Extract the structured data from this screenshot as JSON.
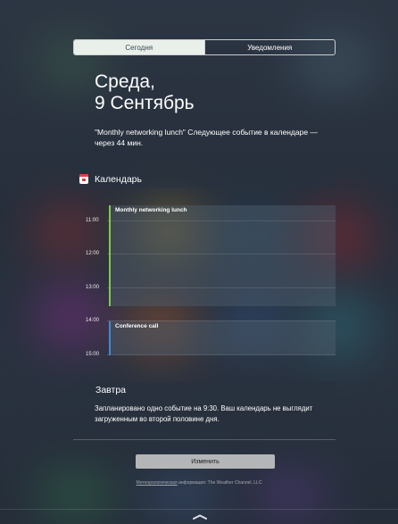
{
  "segmented": {
    "today": "Сегодня",
    "notifications": "Уведомления"
  },
  "date": {
    "weekday": "Среда,",
    "day_month": "9 Сентябрь"
  },
  "summary": "\"Monthly networking lunch\" Следующее событие в календаре — через 44 мин.",
  "calendar_section": {
    "title": "Календарь",
    "hours": [
      "11:00",
      "12:00",
      "13:00",
      "14:00",
      "15:00"
    ],
    "events": [
      {
        "title": "Monthly networking lunch",
        "color": "#7ccc4a"
      },
      {
        "title": "Conference call",
        "color": "#3c8bd6"
      }
    ]
  },
  "tomorrow": {
    "title": "Завтра",
    "text": "Запланировано одно событие на 9:30. Ваш календарь не выглядит загруженным во второй половине дня."
  },
  "edit_button": "Изменить",
  "credit": {
    "link": "Метеорологическая",
    "rest": " информация: The Weather Channel, LLC"
  },
  "icons": [
    "calendar-icon",
    "chevron-up-handle-icon"
  ]
}
